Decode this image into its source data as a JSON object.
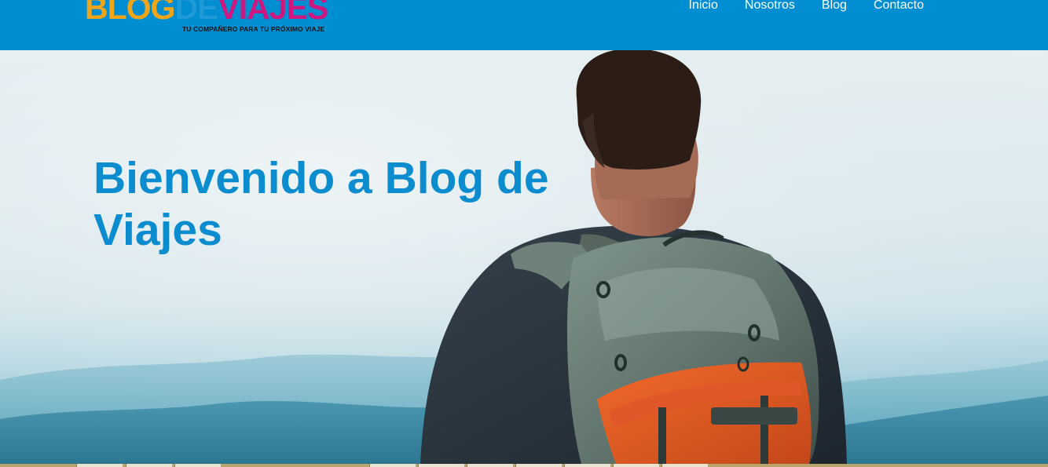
{
  "header": {
    "logo": {
      "blog": "BLOG",
      "de": "DE",
      "viajes": "VIAJES",
      "tagline": "TU COMPAÑERO PARA TU PRÓXIMO VIAJE"
    },
    "nav": [
      {
        "label": "Inicio"
      },
      {
        "label": "Nosotros"
      },
      {
        "label": "Blog"
      },
      {
        "label": "Contacto"
      }
    ],
    "colors": {
      "background": "#008ed3",
      "logo_blog": "#f2a516",
      "logo_de": "#1e9ad6",
      "logo_viajes": "#d0177f",
      "nav_text": "#ffffff"
    }
  },
  "hero": {
    "title": "Bienvenido a Blog de Viajes",
    "image": "backpacker-looking-at-mountains",
    "colors": {
      "title": "#0a8ccf"
    }
  }
}
